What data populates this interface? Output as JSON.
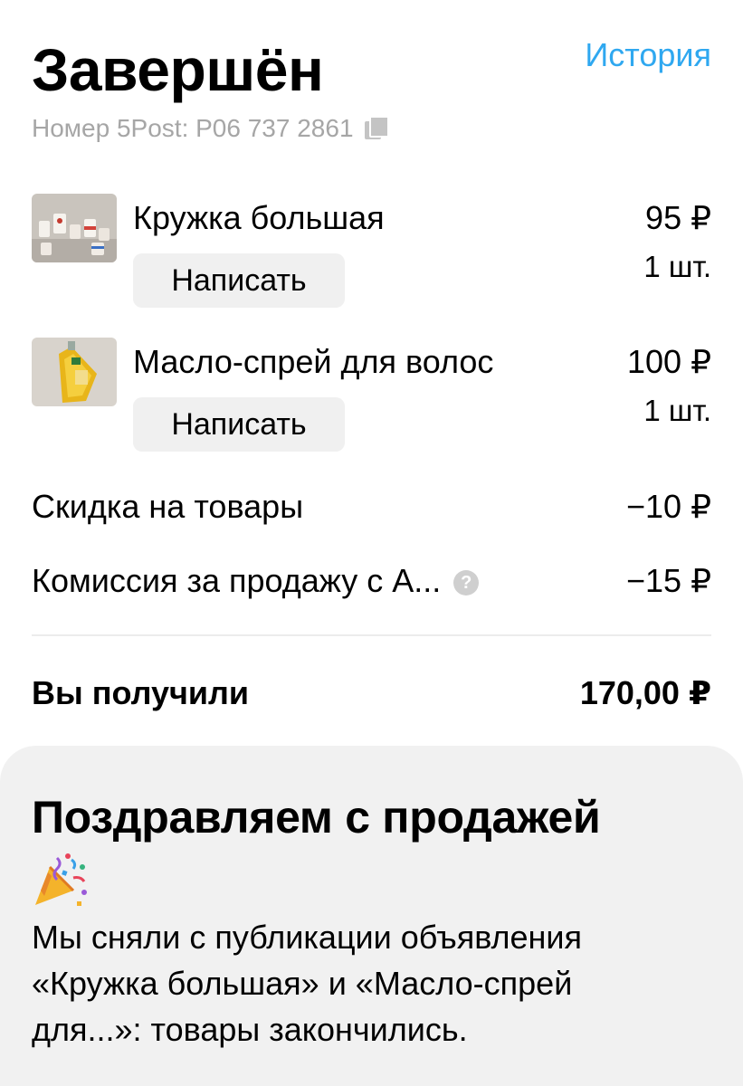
{
  "header": {
    "title": "Завершён",
    "history_label": "История",
    "tracking": "Номер 5Post: P06 737 2861"
  },
  "items": [
    {
      "name": "Кружка большая",
      "price": "95 ₽",
      "qty": "1 шт.",
      "button": "Написать"
    },
    {
      "name": "Масло-спрей для волос",
      "price": "100 ₽",
      "qty": "1 шт.",
      "button": "Написать"
    }
  ],
  "summary": {
    "discount_label": "Скидка на товары",
    "discount_value": "−10 ₽",
    "commission_label": "Комиссия за продажу с А...",
    "commission_value": "−15 ₽",
    "help_icon": "?",
    "total_label": "Вы получили",
    "total_value": "170,00 ₽"
  },
  "congrats": {
    "heading": "Поздравляем с продажей",
    "icon": "party-popper-icon",
    "line1": "Мы сняли с публикации объявления",
    "line2": "«Кружка большая» и «Масло-спрей",
    "line3": "для...»: товары закончились."
  },
  "colors": {
    "accent": "#2fa8f0",
    "muted": "#a6a6a6",
    "button_bg": "#f0f0f0",
    "panel_bg": "#f1f1f1"
  }
}
